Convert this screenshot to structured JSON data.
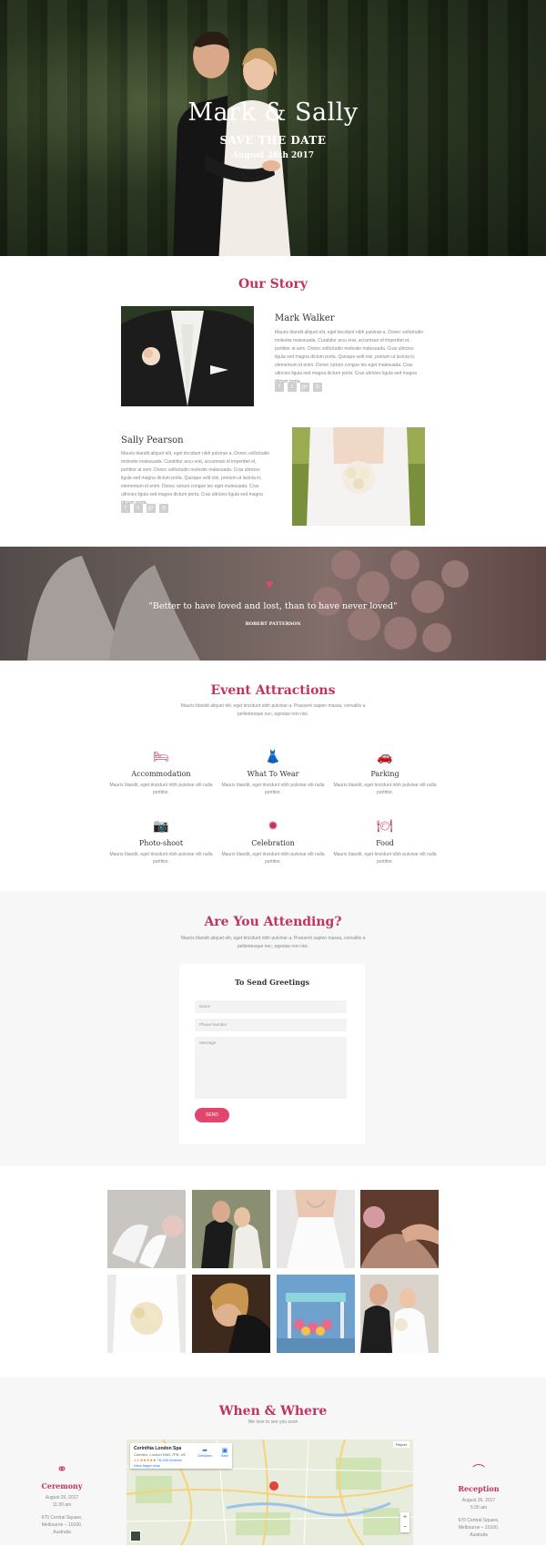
{
  "hero": {
    "title": "Mark & Sally",
    "subtitle": "SAVE THE DATE",
    "date": "August 26th 2017"
  },
  "story": {
    "title": "Our Story",
    "groom": {
      "name": "Mark Walker",
      "bio": "Mauris blandit aliquet elit, eget tincidunt nibh pulvinar a. Donec sollicitudin molestie malesuada. Curabitur arcu erat, accumsan id imperdiet et, porttitor at sem. Donec sollicitudin molestie malesuada. Cras ultricies ligula sed magna dictum porta. Quisque velit nisi, pretium ut lacinia in, elementum id enim. Donec rutrum congue leo eget malesuada. Cras ultricies ligula sed magna dictum porta. Cras ultricies ligula sed magna dictum porta."
    },
    "bride": {
      "name": "Sally Pearson",
      "bio": "Mauris blandit aliquet elit, eget tincidunt nibh pulvinar a. Donec sollicitudin molestie malesuada. Curabitur arcu erat, accumsan id imperdiet et, porttitor at sem. Donec sollicitudin molestie malesuada. Cras ultricies ligula sed magna dictum porta. Quisque velit nisi, pretium ut lacinia in, elementum id enim. Donec rutrum congue leo eget malesuada. Cras ultricies ligula sed magna dictum porta. Cras ultricies ligula sed magna dictum porta."
    },
    "social_icons": [
      "facebook-icon",
      "twitter-icon",
      "google-plus-icon",
      "instagram-icon"
    ],
    "social_glyphs": [
      "f",
      "t",
      "g+",
      "◎"
    ]
  },
  "quote": {
    "text": "\"Better to have loved and lost, than to have never loved\"",
    "author": "ROBERT PATTERSON"
  },
  "attractions": {
    "title": "Event Attractions",
    "intro": "Mauris blandit aliquet elit, eget tincidunt nibh pulvinar a. Praesent sapien massa, convallis a pellentesque nec, egestas non nisi.",
    "items": [
      {
        "title": "Accommodation",
        "desc": "Mauris blandit, eget tincidunt nibh pulvinar elit nulla porttitor.",
        "icon": "bed-icon",
        "glyph": "🛏"
      },
      {
        "title": "What To Wear",
        "desc": "Mauris blandit, eget tincidunt nibh pulvinar elit nulla porttitor.",
        "icon": "dress-icon",
        "glyph": "👗"
      },
      {
        "title": "Parking",
        "desc": "Mauris blandit, eget tincidunt nibh pulvinar elit nulla porttitor.",
        "icon": "car-icon",
        "glyph": "🚗"
      },
      {
        "title": "Photo-shoot",
        "desc": "Mauris blandit, eget tincidunt nibh pulvinar elit nulla porttitor.",
        "icon": "camera-icon",
        "glyph": "📷"
      },
      {
        "title": "Celebration",
        "desc": "Mauris blandit, eget tincidunt nibh pulvinar elit nulla porttitor.",
        "icon": "fireworks-icon",
        "glyph": "✹"
      },
      {
        "title": "Food",
        "desc": "Mauris blandit, eget tincidunt nibh pulvinar elit nulla porttitor.",
        "icon": "food-icon",
        "glyph": "🍽"
      }
    ]
  },
  "rsvp": {
    "title": "Are You Attending?",
    "intro": "Mauris blandit aliquet elit, eget tincidunt nibh pulvinar a. Praesent sapien massa, convallis a pellentesque nec, egestas non nisi.",
    "form_title": "To Send Greetings",
    "name_placeholder": "Name",
    "phone_placeholder": "Phone Number",
    "message_placeholder": "Message",
    "send_label": "SEND"
  },
  "when": {
    "title": "When & Where",
    "subtitle": "We love to see you soon",
    "ceremony": {
      "title": "Ceremony",
      "date": "August 26, 2017",
      "time": "11:30 am",
      "address1": "670 Central Square,",
      "address2": "Melbourne – 10160,",
      "country": "Australia"
    },
    "reception": {
      "title": "Reception",
      "date": "August 26, 2017",
      "time": "5:30 am",
      "address1": "670 Central Square,",
      "address2": "Melbourne – 10160,",
      "country": "Australia"
    },
    "map": {
      "place": "Corinthia London Spa",
      "address": "Camden, London NW1 7PB, UK",
      "rating": "4.5",
      "reviews": "76,245 reviews",
      "larger_map": "View larger map",
      "directions": "Directions",
      "save": "Save",
      "report": "Report"
    }
  }
}
